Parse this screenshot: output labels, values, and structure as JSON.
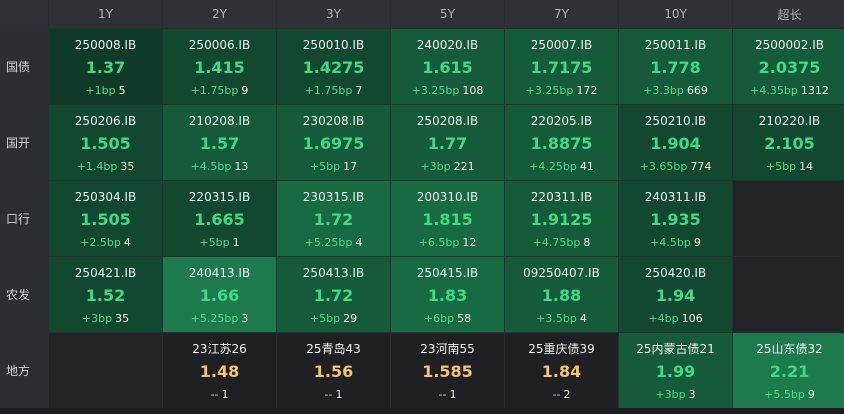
{
  "columns": [
    "1Y",
    "2Y",
    "3Y",
    "5Y",
    "7Y",
    "10Y",
    "超长"
  ],
  "rows": [
    {
      "label": "国债",
      "cells": [
        {
          "code": "250008.IB",
          "yield": "1.37",
          "delta": "+1bp",
          "vol": "5",
          "tone": "g1",
          "color": "g"
        },
        {
          "code": "250006.IB",
          "yield": "1.415",
          "delta": "+1.75bp",
          "vol": "9",
          "tone": "g2",
          "color": "g"
        },
        {
          "code": "250010.IB",
          "yield": "1.4275",
          "delta": "+1.75bp",
          "vol": "7",
          "tone": "g2",
          "color": "g"
        },
        {
          "code": "240020.IB",
          "yield": "1.615",
          "delta": "+3.25bp",
          "vol": "108",
          "tone": "g3",
          "color": "g"
        },
        {
          "code": "250007.IB",
          "yield": "1.7175",
          "delta": "+3.25bp",
          "vol": "172",
          "tone": "g3",
          "color": "g"
        },
        {
          "code": "250011.IB",
          "yield": "1.778",
          "delta": "+3.3bp",
          "vol": "669",
          "tone": "g3",
          "color": "g"
        },
        {
          "code": "2500002.IB",
          "yield": "2.0375",
          "delta": "+4.35bp",
          "vol": "1312",
          "tone": "g3",
          "color": "g"
        }
      ]
    },
    {
      "label": "国开",
      "cells": [
        {
          "code": "250206.IB",
          "yield": "1.505",
          "delta": "+1.4bp",
          "vol": "35",
          "tone": "g2",
          "color": "g"
        },
        {
          "code": "210208.IB",
          "yield": "1.57",
          "delta": "+4.5bp",
          "vol": "13",
          "tone": "g3",
          "color": "g"
        },
        {
          "code": "230208.IB",
          "yield": "1.6975",
          "delta": "+5bp",
          "vol": "17",
          "tone": "g3",
          "color": "g"
        },
        {
          "code": "250208.IB",
          "yield": "1.77",
          "delta": "+3bp",
          "vol": "221",
          "tone": "g3",
          "color": "g"
        },
        {
          "code": "220205.IB",
          "yield": "1.8875",
          "delta": "+4.25bp",
          "vol": "41",
          "tone": "g3",
          "color": "g"
        },
        {
          "code": "250210.IB",
          "yield": "1.904",
          "delta": "+3.65bp",
          "vol": "774",
          "tone": "g2",
          "color": "g"
        },
        {
          "code": "210220.IB",
          "yield": "2.105",
          "delta": "+5bp",
          "vol": "14",
          "tone": "g2",
          "color": "g"
        }
      ]
    },
    {
      "label": "口行",
      "cells": [
        {
          "code": "250304.IB",
          "yield": "1.505",
          "delta": "+2.5bp",
          "vol": "4",
          "tone": "g2",
          "color": "g"
        },
        {
          "code": "220315.IB",
          "yield": "1.665",
          "delta": "+5bp",
          "vol": "1",
          "tone": "g2",
          "color": "g"
        },
        {
          "code": "230315.IB",
          "yield": "1.72",
          "delta": "+5.25bp",
          "vol": "4",
          "tone": "g4",
          "color": "g"
        },
        {
          "code": "200310.IB",
          "yield": "1.815",
          "delta": "+6.5bp",
          "vol": "12",
          "tone": "g4",
          "color": "g"
        },
        {
          "code": "220311.IB",
          "yield": "1.9125",
          "delta": "+4.75bp",
          "vol": "8",
          "tone": "g3",
          "color": "g"
        },
        {
          "code": "240311.IB",
          "yield": "1.935",
          "delta": "+4.5bp",
          "vol": "9",
          "tone": "g2",
          "color": "g"
        },
        null
      ]
    },
    {
      "label": "农发",
      "cells": [
        {
          "code": "250421.IB",
          "yield": "1.52",
          "delta": "+3bp",
          "vol": "35",
          "tone": "g2",
          "color": "g"
        },
        {
          "code": "240413.IB",
          "yield": "1.66",
          "delta": "+5.25bp",
          "vol": "3",
          "tone": "g5",
          "color": "g"
        },
        {
          "code": "250413.IB",
          "yield": "1.72",
          "delta": "+5bp",
          "vol": "29",
          "tone": "g3",
          "color": "g"
        },
        {
          "code": "250415.IB",
          "yield": "1.83",
          "delta": "+6bp",
          "vol": "58",
          "tone": "g4",
          "color": "g"
        },
        {
          "code": "09250407.IB",
          "yield": "1.88",
          "delta": "+3.5bp",
          "vol": "4",
          "tone": "g3",
          "color": "g"
        },
        {
          "code": "250420.IB",
          "yield": "1.94",
          "delta": "+4bp",
          "vol": "106",
          "tone": "g2",
          "color": "g"
        },
        null
      ]
    },
    {
      "label": "地方",
      "cells": [
        null,
        {
          "code": "23江苏26",
          "yield": "1.48",
          "delta": "--",
          "vol": "1",
          "tone": "dk",
          "color": "o"
        },
        {
          "code": "25青岛43",
          "yield": "1.56",
          "delta": "--",
          "vol": "1",
          "tone": "dk",
          "color": "o"
        },
        {
          "code": "23河南55",
          "yield": "1.585",
          "delta": "--",
          "vol": "1",
          "tone": "dk",
          "color": "o"
        },
        {
          "code": "25重庆债39",
          "yield": "1.84",
          "delta": "--",
          "vol": "2",
          "tone": "dk",
          "color": "o"
        },
        {
          "code": "25内蒙古债21",
          "yield": "1.99",
          "delta": "+3bp",
          "vol": "3",
          "tone": "g3",
          "color": "g"
        },
        {
          "code": "25山东债32",
          "yield": "2.21",
          "delta": "+5.5bp",
          "vol": "9",
          "tone": "g5",
          "color": "g"
        }
      ]
    }
  ]
}
